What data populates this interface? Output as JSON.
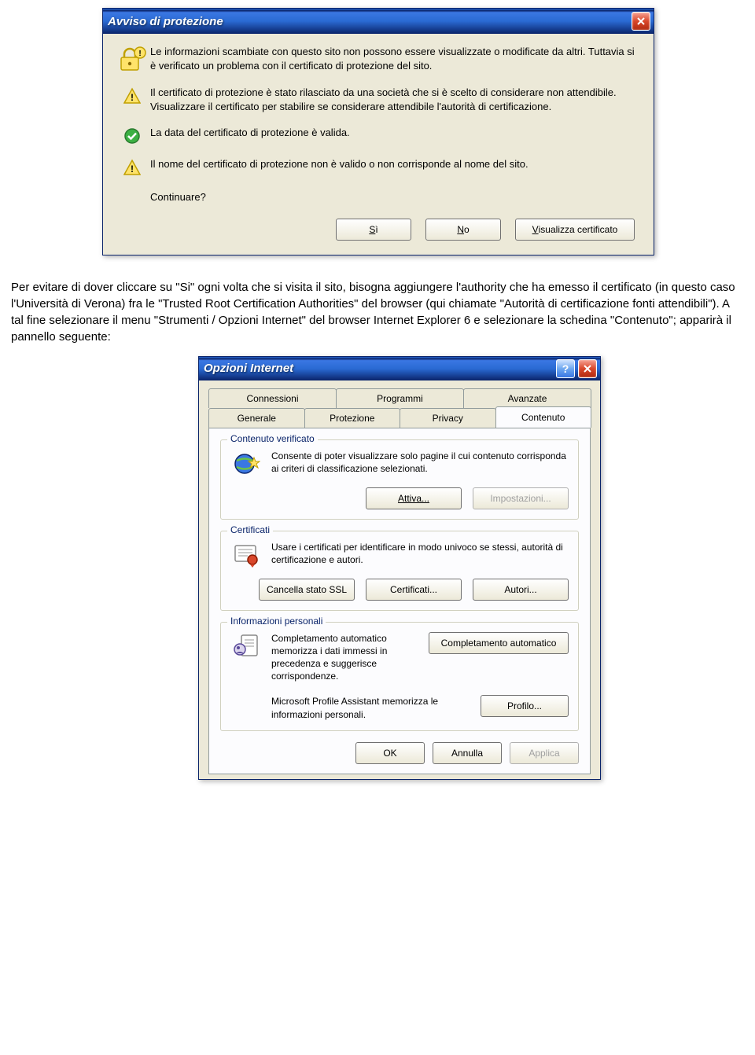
{
  "alert": {
    "title": "Avviso di protezione",
    "main_text": "Le informazioni scambiate con questo sito non possono essere visualizzate o modificate da altri. Tuttavia si è verificato un problema con il certificato di protezione del sito.",
    "item1": "Il certificato di protezione è stato rilasciato da una società che si è scelto di considerare non attendibile. Visualizzare il certificato per stabilire se considerare attendibile l'autorità di certificazione.",
    "item2": "La data del certificato di protezione è valida.",
    "item3": "Il nome del certificato di protezione non è valido o non corrisponde al nome del sito.",
    "continue": "Continuare?",
    "btn_yes_pre": "",
    "btn_yes_u": "S",
    "btn_yes_post": "ì",
    "btn_no_pre": "",
    "btn_no_u": "N",
    "btn_no_post": "o",
    "btn_view_pre": "",
    "btn_view_u": "V",
    "btn_view_post": "isualizza certificato"
  },
  "mid_paragraph": "Per evitare di dover cliccare su \"Si\" ogni volta che si visita il sito, bisogna aggiungere l'authority che ha emesso il certificato (in questo caso l'Università di Verona) fra le \"Trusted Root Certification Authorities\" del browser (qui chiamate \"Autorità di certificazione fonti attendibili\"). A tal fine selezionare il menu \"Strumenti / Opzioni Internet\" del browser Internet Explorer 6 e selezionare la schedina \"Contenuto\"; apparirà il pannello seguente:",
  "options": {
    "title": "Opzioni Internet",
    "tabs_top": [
      "Connessioni",
      "Programmi",
      "Avanzate"
    ],
    "tabs_bottom": [
      "Generale",
      "Protezione",
      "Privacy",
      "Contenuto"
    ],
    "verified": {
      "legend": "Contenuto verificato",
      "text": "Consente di poter visualizzare solo pagine il cui contenuto corrisponda ai criteri di classificazione selezionati.",
      "btn_enable": "Attiva...",
      "btn_settings": "Impostazioni..."
    },
    "certs": {
      "legend": "Certificati",
      "text": "Usare i certificati per identificare in modo univoco se stessi, autorità di certificazione e autori.",
      "btn_clear": "Cancella stato SSL",
      "btn_certs": "Certificati...",
      "btn_authors": "Autori..."
    },
    "personal": {
      "legend": "Informazioni personali",
      "text1": "Completamento automatico memorizza i dati immessi in precedenza e suggerisce corrispondenze.",
      "btn_auto": "Completamento automatico",
      "text2": "Microsoft Profile Assistant memorizza le informazioni personali.",
      "btn_profile": "Profilo..."
    },
    "footer": {
      "ok": "OK",
      "cancel": "Annulla",
      "apply": "Applica"
    }
  }
}
